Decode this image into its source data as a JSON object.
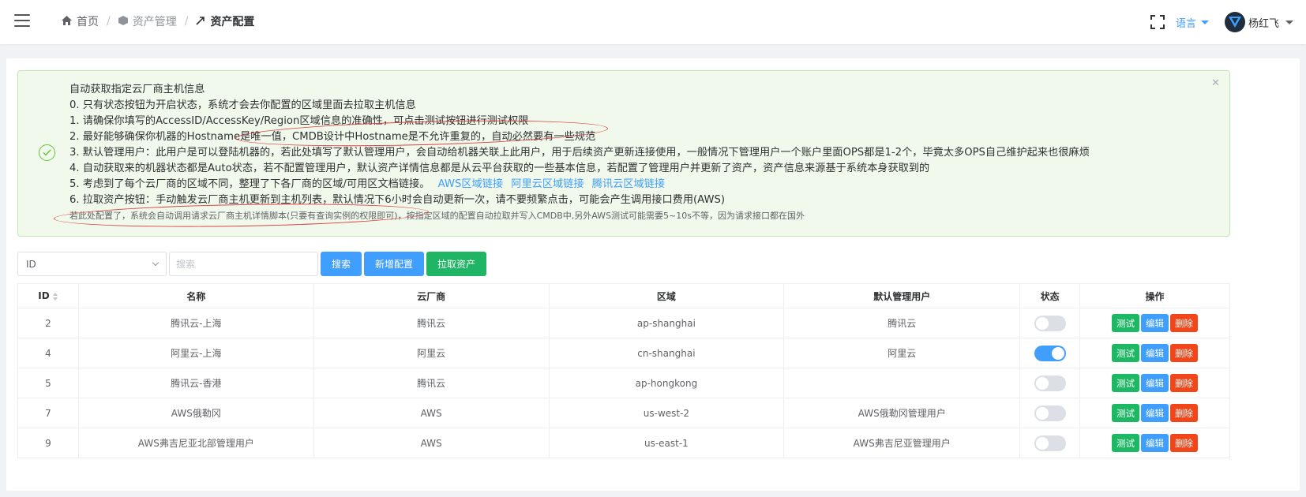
{
  "header": {
    "breadcrumb": [
      {
        "label": "首页",
        "icon": "home-icon"
      },
      {
        "label": "资产管理",
        "icon": "box-icon"
      },
      {
        "label": "资产配置",
        "icon": "arrow-icon"
      }
    ],
    "language_label": "语言",
    "user_name": "杨红飞"
  },
  "alert": {
    "lines": [
      "自动获取指定云厂商主机信息",
      "0. 只有状态按钮为开启状态，系统才会去你配置的区域里面去拉取主机信息",
      "1. 请确保你填写的AccessID/AccessKey/Region区域信息的准确性，可点击测试按钮进行测试权限",
      "2. 最好能够确保你机器的Hostname是唯一值，CMDB设计中Hostname是不允许重复的，自动必然要有一些规范",
      "3. 默认管理用户：此用户是可以登陆机器的，若此处填写了默认管理用户，会自动给机器关联上此用户，用于后续资产更新连接使用，一般情况下管理用户一个账户里面OPS都是1-2个，毕竟太多OPS自己维护起来也很麻烦",
      "4. 自动获取来的机器状态都是Auto状态，若不配置管理用户，默认资产详情信息都是从云平台获取的一些基本信息，若配置了管理用户并更新了资产，资产信息来源基于系统本身获取到的",
      "5. 考虑到了每个云厂商的区域不同，整理了下各厂商的区域/可用区文档链接。"
    ],
    "links": [
      "AWS区域链接",
      "阿里云区域链接",
      "腾讯云区域链接"
    ],
    "line6": "6. 拉取资产按钮：手动触发云厂商主机更新到主机列表，默认情况下6小时会自动更新一次，请不要频繁点击，可能会产生调用接口费用(AWS)",
    "note": "若此处配置了，系统会自动调用请求云厂商主机详情脚本(只要有查询实例的权限即可)，按指定区域的配置自动拉取并写入CMDB中,另外AWS测试可能需要5~10s不等，因为请求接口都在国外"
  },
  "filter": {
    "select_value": "ID",
    "search_placeholder": "搜索",
    "search_button": "搜索",
    "add_button": "新增配置",
    "pull_button": "拉取资产"
  },
  "table": {
    "columns": [
      "ID",
      "名称",
      "云厂商",
      "区域",
      "默认管理用户",
      "状态",
      "操作"
    ],
    "action_labels": {
      "test": "测试",
      "edit": "编辑",
      "delete": "删除"
    },
    "rows": [
      {
        "id": "2",
        "name": "腾讯云-上海",
        "vendor": "腾讯云",
        "region": "ap-shanghai",
        "admin_user": "腾讯云",
        "enabled": false
      },
      {
        "id": "4",
        "name": "阿里云-上海",
        "vendor": "阿里云",
        "region": "cn-shanghai",
        "admin_user": "阿里云",
        "enabled": true
      },
      {
        "id": "5",
        "name": "腾讯云-香港",
        "vendor": "腾讯云",
        "region": "ap-hongkong",
        "admin_user": "",
        "enabled": false
      },
      {
        "id": "7",
        "name": "AWS俄勒冈",
        "vendor": "AWS",
        "region": "us-west-2",
        "admin_user": "AWS俄勒冈管理用户",
        "enabled": false
      },
      {
        "id": "9",
        "name": "AWS弗吉尼亚北部管理用户",
        "vendor": "AWS",
        "region": "us-east-1",
        "admin_user": "AWS弗吉尼亚管理用户",
        "enabled": false
      }
    ]
  },
  "colors": {
    "primary": "#409eff",
    "success": "#20b565",
    "danger": "#f0461a",
    "alert_bg": "#f0f9eb"
  }
}
